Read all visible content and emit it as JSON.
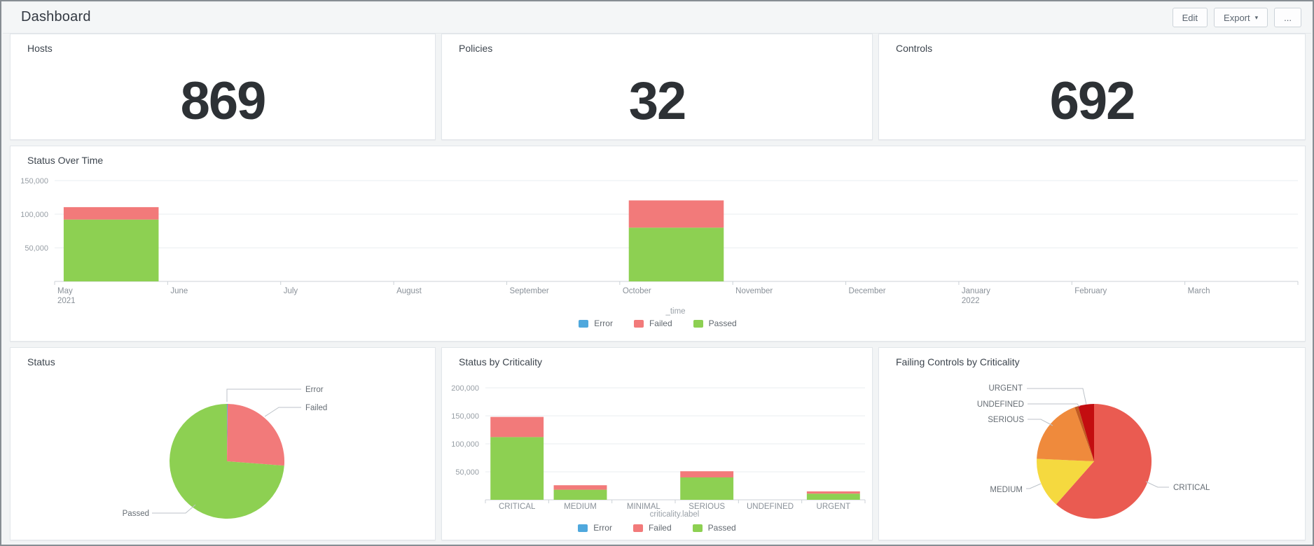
{
  "header": {
    "title": "Dashboard",
    "edit_label": "Edit",
    "export_label": "Export",
    "more_label": "..."
  },
  "kpis": [
    {
      "title": "Hosts",
      "value": "869"
    },
    {
      "title": "Policies",
      "value": "32"
    },
    {
      "title": "Controls",
      "value": "692"
    }
  ],
  "colors": {
    "error": "#4FA8DD",
    "failed": "#F27A7A",
    "passed": "#8DD052"
  },
  "chart_data": [
    {
      "id": "status-over-time",
      "type": "bar",
      "stacked": true,
      "title": "Status Over Time",
      "xlabel": "_time",
      "categories": [
        {
          "label": "May",
          "sub": "2021"
        },
        {
          "label": "June"
        },
        {
          "label": "July"
        },
        {
          "label": "August"
        },
        {
          "label": "September"
        },
        {
          "label": "October"
        },
        {
          "label": "November"
        },
        {
          "label": "December"
        },
        {
          "label": "January",
          "sub": "2022"
        },
        {
          "label": "February"
        },
        {
          "label": "March"
        }
      ],
      "ylim": [
        0,
        150000
      ],
      "yticks": [
        50000,
        100000,
        150000
      ],
      "grid": true,
      "legend_position": "bottom",
      "series": [
        {
          "name": "Error",
          "color": "#4FA8DD",
          "values": [
            0,
            0,
            0,
            0,
            0,
            0,
            0,
            0,
            0,
            0,
            0
          ]
        },
        {
          "name": "Failed",
          "color": "#F27A7A",
          "values": [
            18500,
            0,
            0,
            0,
            0,
            40500,
            0,
            0,
            0,
            0,
            0
          ]
        },
        {
          "name": "Passed",
          "color": "#8DD052",
          "values": [
            92000,
            0,
            0,
            0,
            0,
            80000,
            0,
            0,
            0,
            0,
            0
          ]
        }
      ]
    },
    {
      "id": "status-pie",
      "type": "pie",
      "title": "Status",
      "labels": [
        "Error",
        "Failed",
        "Passed"
      ],
      "values": [
        0.2,
        26.0,
        73.8
      ],
      "colors": [
        "#4FA8DD",
        "#F27A7A",
        "#8DD052"
      ]
    },
    {
      "id": "status-by-criticality",
      "type": "bar",
      "stacked": true,
      "title": "Status by Criticality",
      "xlabel": "criticality.label",
      "categories": [
        {
          "label": "CRITICAL"
        },
        {
          "label": "MEDIUM"
        },
        {
          "label": "MINIMAL"
        },
        {
          "label": "SERIOUS"
        },
        {
          "label": "UNDEFINED"
        },
        {
          "label": "URGENT"
        }
      ],
      "ylim": [
        0,
        200000
      ],
      "yticks": [
        50000,
        100000,
        150000,
        200000
      ],
      "grid": true,
      "legend_position": "bottom",
      "series": [
        {
          "name": "Error",
          "color": "#4FA8DD",
          "values": [
            0,
            0,
            0,
            0,
            0,
            0
          ]
        },
        {
          "name": "Failed",
          "color": "#F27A7A",
          "values": [
            36000,
            8000,
            0,
            11000,
            0,
            4000
          ]
        },
        {
          "name": "Passed",
          "color": "#8DD052",
          "values": [
            112000,
            18000,
            0,
            40000,
            0,
            11000
          ]
        }
      ]
    },
    {
      "id": "failing-controls-pie",
      "type": "pie",
      "title": "Failing Controls by Criticality",
      "labels": [
        "CRITICAL",
        "MEDIUM",
        "SERIOUS",
        "UNDEFINED",
        "URGENT"
      ],
      "values": [
        61.5,
        14.2,
        18.8,
        1.0,
        4.5
      ],
      "colors": [
        "#EA5B51",
        "#F5D93F",
        "#EF8A3C",
        "#C25B21",
        "#C30D10"
      ]
    }
  ]
}
